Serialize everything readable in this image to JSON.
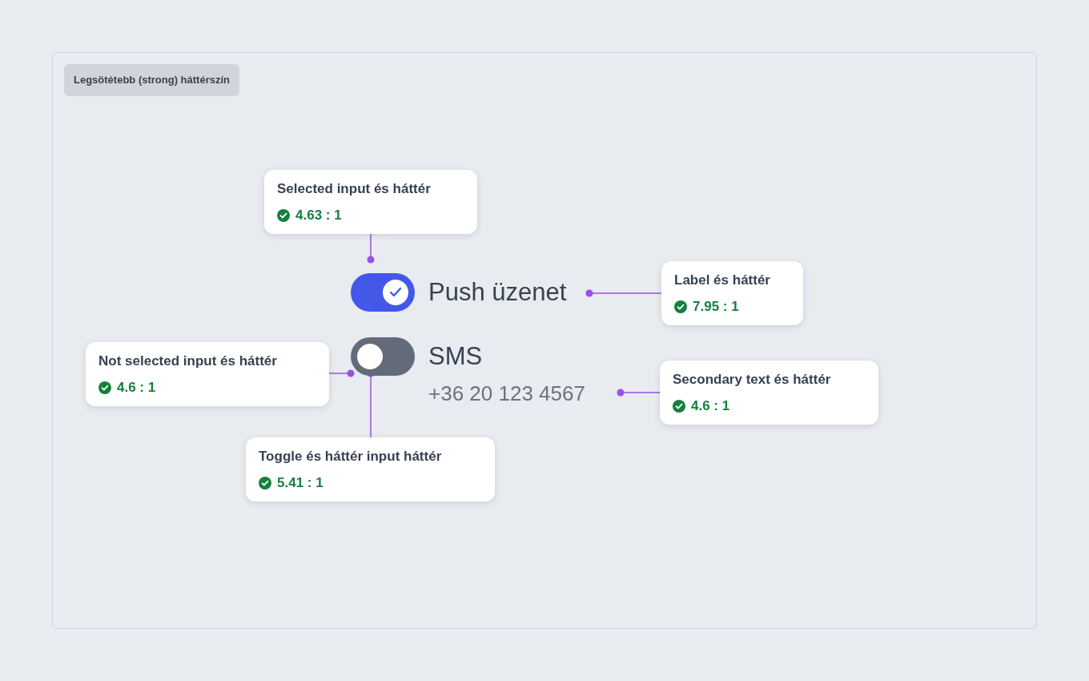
{
  "badge": "Legsötétebb (strong) háttérszín",
  "toggles": [
    {
      "label": "Push üzenet",
      "on": true
    },
    {
      "label": "SMS",
      "on": false,
      "secondary": "+36 20 123 4567"
    }
  ],
  "annotations": [
    {
      "title": "Selected input és háttér",
      "ratio": "4.63 : 1",
      "passed": true
    },
    {
      "title": "Label és háttér",
      "ratio": "7.95 : 1",
      "passed": true
    },
    {
      "title": "Not selected input és háttér",
      "ratio": "4.6 : 1",
      "passed": true
    },
    {
      "title": "Secondary text és háttér",
      "ratio": "4.6 : 1",
      "passed": true
    },
    {
      "title": "Toggle és háttér input háttér",
      "ratio": "5.41 : 1",
      "passed": true
    }
  ]
}
